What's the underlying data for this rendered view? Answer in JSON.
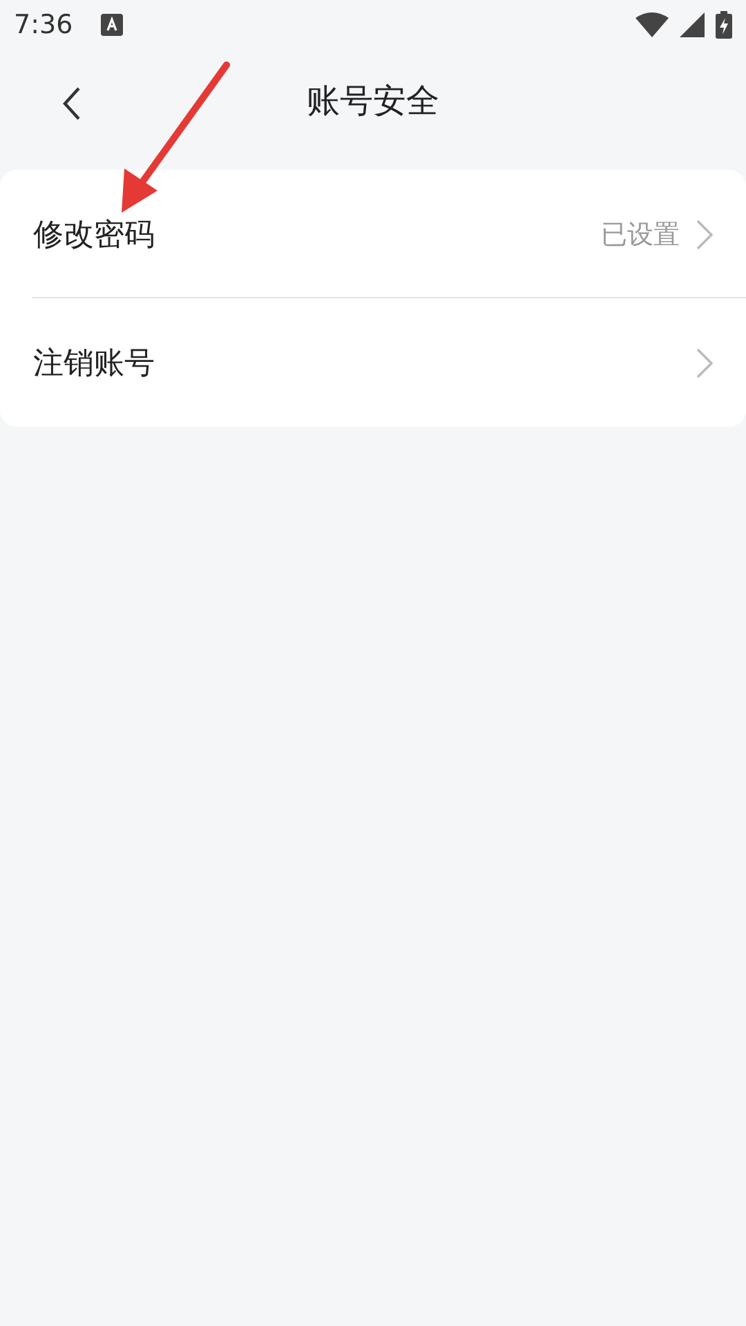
{
  "status_bar": {
    "time": "7:36"
  },
  "header": {
    "title": "账号安全"
  },
  "rows": [
    {
      "label": "修改密码",
      "value": "已设置"
    },
    {
      "label": "注销账号"
    }
  ]
}
